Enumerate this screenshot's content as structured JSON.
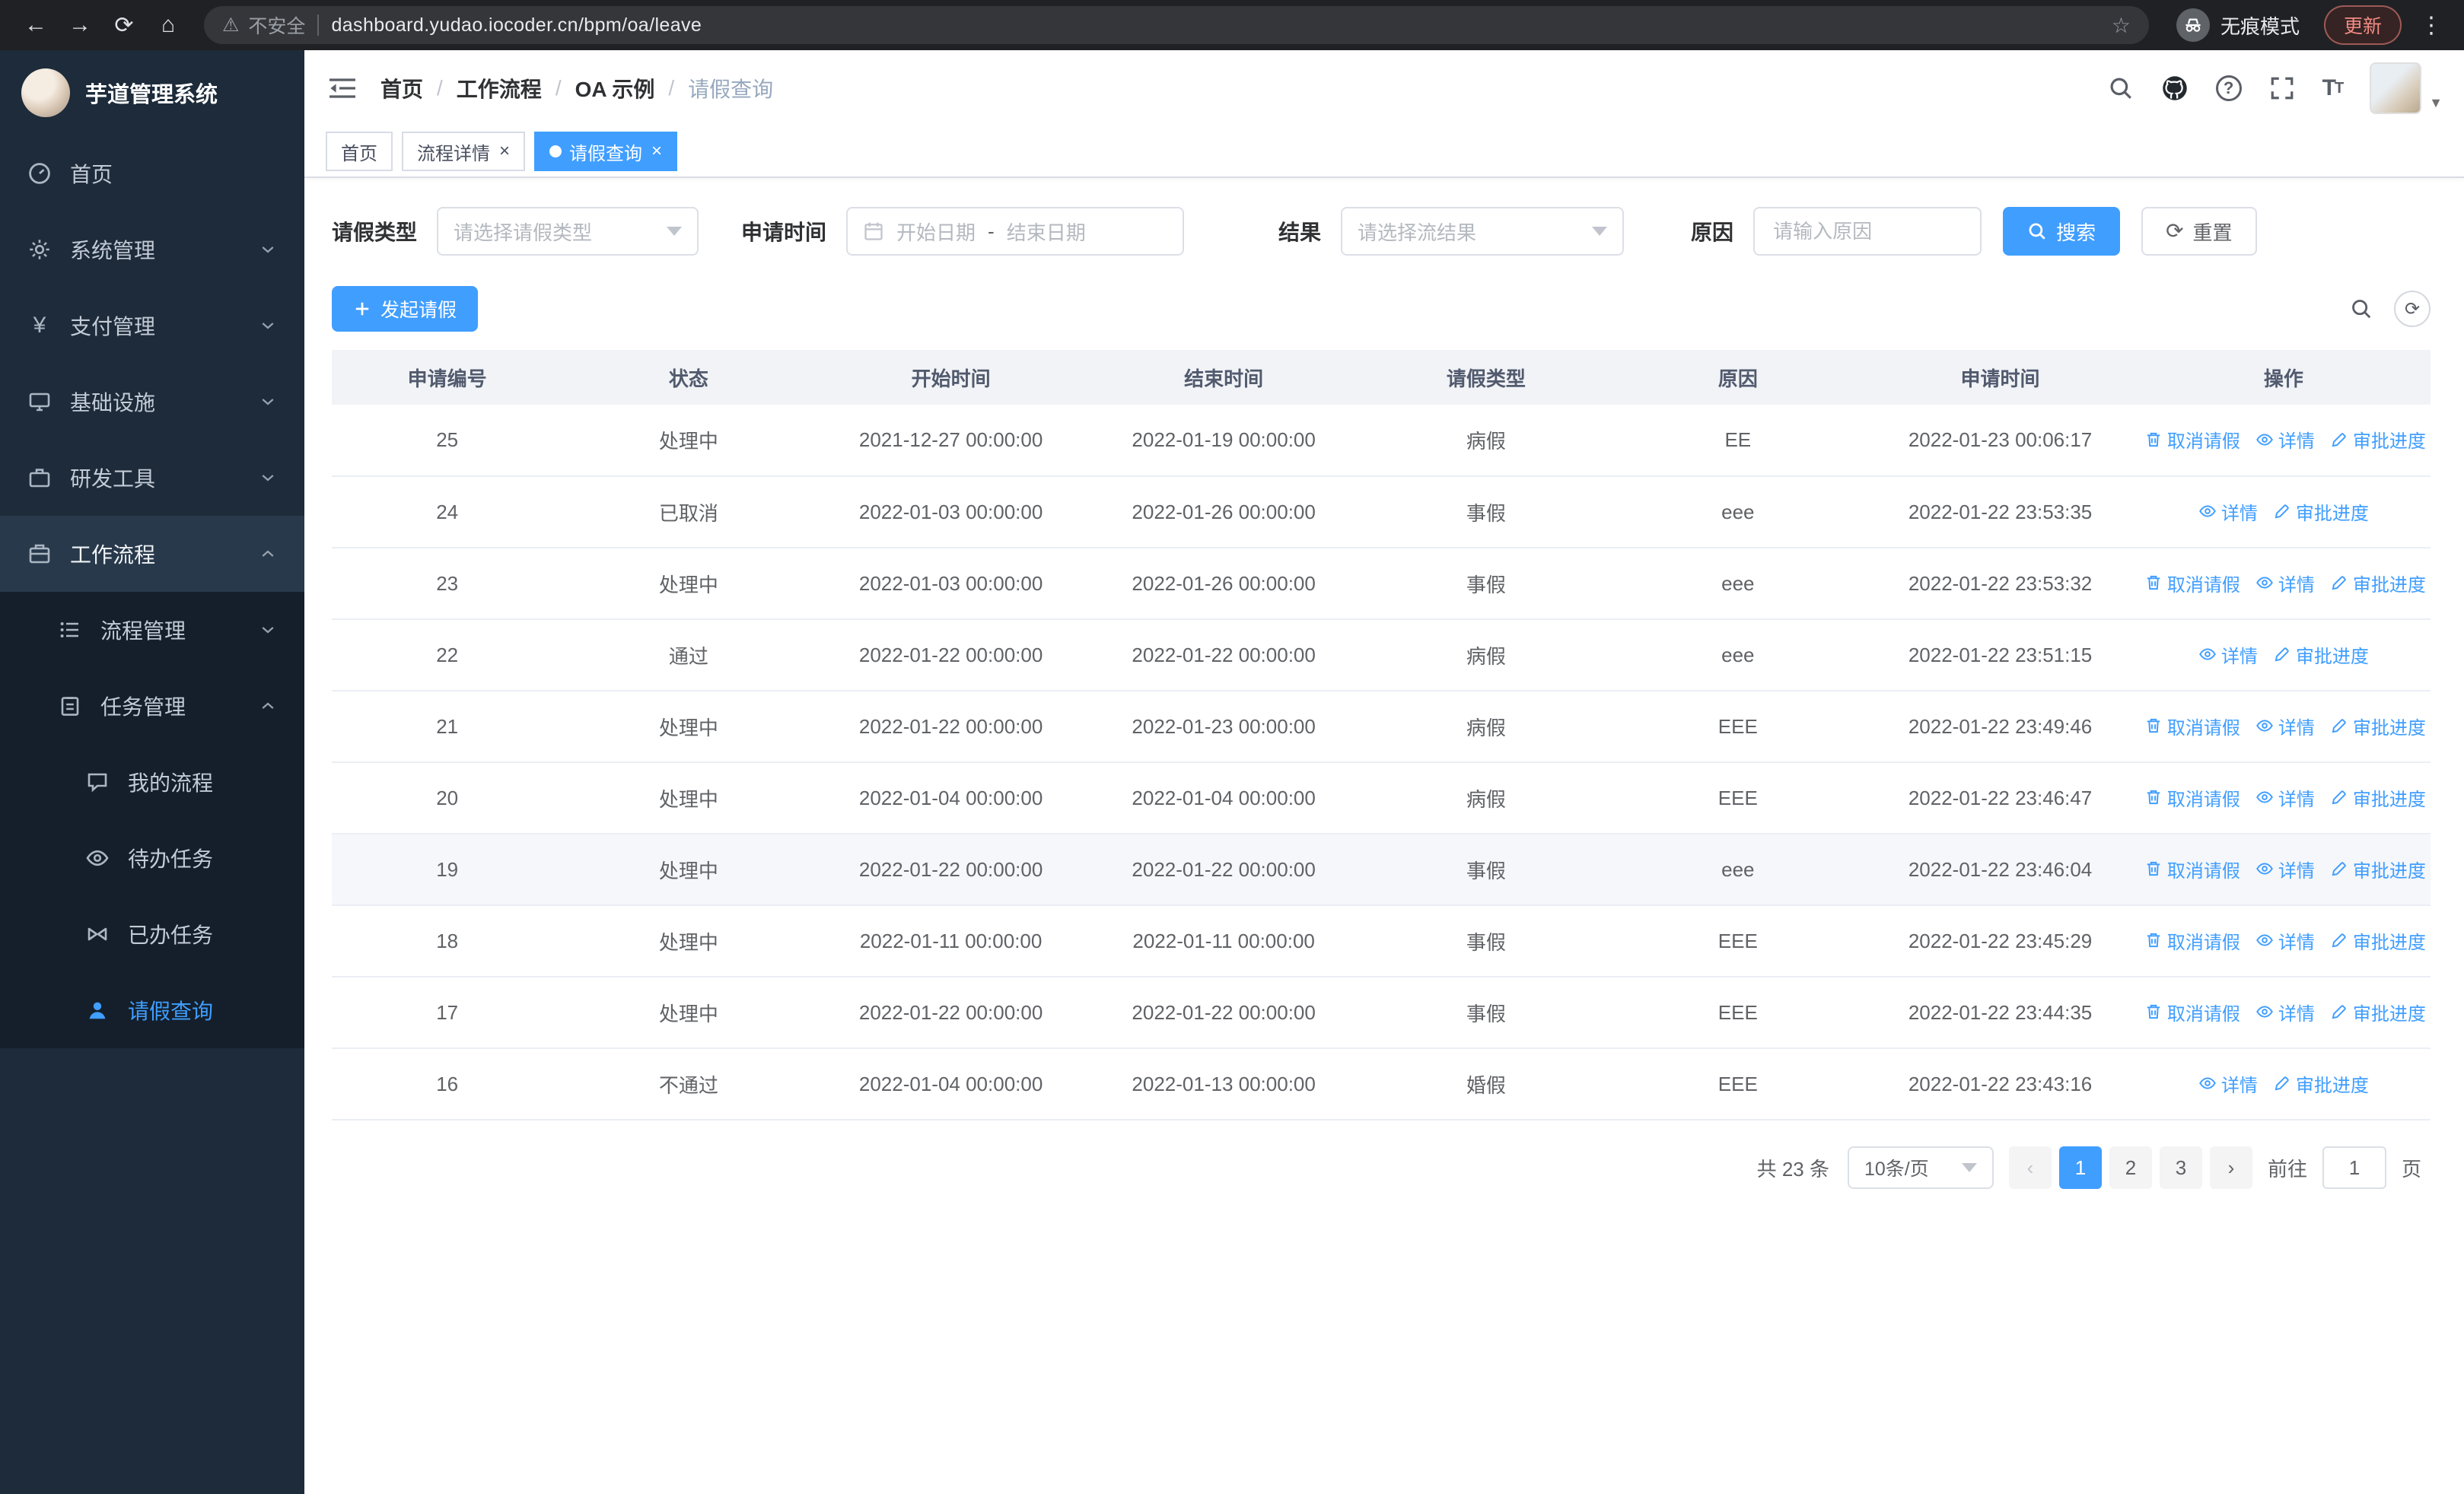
{
  "theme": {
    "primary": "#409eff",
    "chrome_bg": "#202124",
    "sidebar_bg": "#1d2b3a",
    "sidebar_sub_bg": "#141f2b",
    "sidebar_active_parent": "#28394b",
    "update_red": "#f28b82"
  },
  "browser": {
    "security_label": "不安全",
    "url": "dashboard.yudao.iocoder.cn/bpm/oa/leave",
    "incognito_label": "无痕模式",
    "update_label": "更新"
  },
  "sidebar": {
    "logo_title": "芋道管理系统",
    "home": "首页",
    "system": "系统管理",
    "payment": "支付管理",
    "infra": "基础设施",
    "devtools": "研发工具",
    "workflow": "工作流程",
    "process_mgmt": "流程管理",
    "task_mgmt": "任务管理",
    "my_process": "我的流程",
    "todo_tasks": "待办任务",
    "done_tasks": "已办任务",
    "leave_query": "请假查询"
  },
  "header": {
    "breadcrumb": [
      "首页",
      "工作流程",
      "OA 示例",
      "请假查询"
    ]
  },
  "tabs": [
    {
      "label": "首页"
    },
    {
      "label": "流程详情"
    },
    {
      "label": "请假查询"
    }
  ],
  "filters": {
    "leave_type_label": "请假类型",
    "leave_type_placeholder": "请选择请假类型",
    "apply_time_label": "申请时间",
    "date_start_placeholder": "开始日期",
    "date_separator": "-",
    "date_end_placeholder": "结束日期",
    "result_label": "结果",
    "result_placeholder": "请选择流结果",
    "reason_label": "原因",
    "reason_placeholder": "请输入原因",
    "search_label": "搜索",
    "reset_label": "重置",
    "create_label": "发起请假"
  },
  "table": {
    "columns": [
      "申请编号",
      "状态",
      "开始时间",
      "结束时间",
      "请假类型",
      "原因",
      "申请时间",
      "操作"
    ],
    "action_labels": {
      "cancel": "取消请假",
      "detail": "详情",
      "progress": "审批进度"
    },
    "highlighted_id": "19",
    "rows": [
      {
        "id": "25",
        "status": "处理中",
        "start": "2021-12-27 00:00:00",
        "end": "2022-01-19 00:00:00",
        "type": "病假",
        "reason": "EE",
        "applied": "2022-01-23 00:06:17",
        "actions": [
          "cancel",
          "detail",
          "progress"
        ]
      },
      {
        "id": "24",
        "status": "已取消",
        "start": "2022-01-03 00:00:00",
        "end": "2022-01-26 00:00:00",
        "type": "事假",
        "reason": "eee",
        "applied": "2022-01-22 23:53:35",
        "actions": [
          "detail",
          "progress"
        ]
      },
      {
        "id": "23",
        "status": "处理中",
        "start": "2022-01-03 00:00:00",
        "end": "2022-01-26 00:00:00",
        "type": "事假",
        "reason": "eee",
        "applied": "2022-01-22 23:53:32",
        "actions": [
          "cancel",
          "detail",
          "progress"
        ]
      },
      {
        "id": "22",
        "status": "通过",
        "start": "2022-01-22 00:00:00",
        "end": "2022-01-22 00:00:00",
        "type": "病假",
        "reason": "eee",
        "applied": "2022-01-22 23:51:15",
        "actions": [
          "detail",
          "progress"
        ]
      },
      {
        "id": "21",
        "status": "处理中",
        "start": "2022-01-22 00:00:00",
        "end": "2022-01-23 00:00:00",
        "type": "病假",
        "reason": "EEE",
        "applied": "2022-01-22 23:49:46",
        "actions": [
          "cancel",
          "detail",
          "progress"
        ]
      },
      {
        "id": "20",
        "status": "处理中",
        "start": "2022-01-04 00:00:00",
        "end": "2022-01-04 00:00:00",
        "type": "病假",
        "reason": "EEE",
        "applied": "2022-01-22 23:46:47",
        "actions": [
          "cancel",
          "detail",
          "progress"
        ]
      },
      {
        "id": "19",
        "status": "处理中",
        "start": "2022-01-22 00:00:00",
        "end": "2022-01-22 00:00:00",
        "type": "事假",
        "reason": "eee",
        "applied": "2022-01-22 23:46:04",
        "actions": [
          "cancel",
          "detail",
          "progress"
        ]
      },
      {
        "id": "18",
        "status": "处理中",
        "start": "2022-01-11 00:00:00",
        "end": "2022-01-11 00:00:00",
        "type": "事假",
        "reason": "EEE",
        "applied": "2022-01-22 23:45:29",
        "actions": [
          "cancel",
          "detail",
          "progress"
        ]
      },
      {
        "id": "17",
        "status": "处理中",
        "start": "2022-01-22 00:00:00",
        "end": "2022-01-22 00:00:00",
        "type": "事假",
        "reason": "EEE",
        "applied": "2022-01-22 23:44:35",
        "actions": [
          "cancel",
          "detail",
          "progress"
        ]
      },
      {
        "id": "16",
        "status": "不通过",
        "start": "2022-01-04 00:00:00",
        "end": "2022-01-13 00:00:00",
        "type": "婚假",
        "reason": "EEE",
        "applied": "2022-01-22 23:43:16",
        "actions": [
          "detail",
          "progress"
        ]
      }
    ]
  },
  "pagination": {
    "total": "共 23 条",
    "page_size": "10条/页",
    "pages": [
      "1",
      "2",
      "3"
    ],
    "active_page": "1",
    "goto_label": "前往",
    "goto_value": "1",
    "goto_suffix": "页"
  }
}
